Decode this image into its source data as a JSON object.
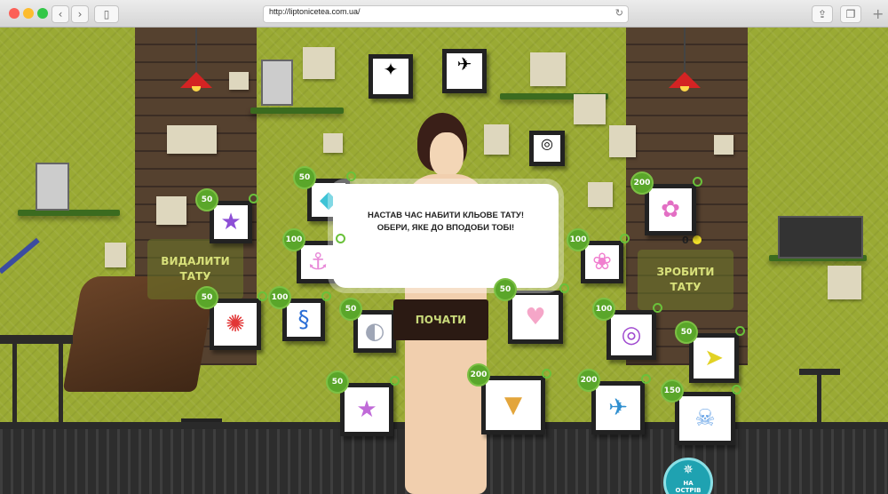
{
  "browser": {
    "url": "http://liptonicetea.com.ua/",
    "traffic_colors": [
      "#fc5f57",
      "#fdbc2e",
      "#33c748"
    ]
  },
  "game": {
    "remove_label_line1": "ВИДАЛИТИ",
    "remove_label_line2": "ТАТУ",
    "make_label_line1": "ЗРОБИТИ",
    "make_label_line2": "ТАТУ",
    "coin_count": "0",
    "modal_line1": "НАСТАВ ЧАС НАБИТИ КЛЬОВЕ ТАТУ!",
    "modal_line2": "ОБЕРИ, ЯКЕ ДО ВПОДОБИ ТОБІ!",
    "start_label": "ПОЧАТИ",
    "island_line1": "НА",
    "island_line2": "ОСТРІВ"
  },
  "tattoos": [
    {
      "name": "star-blue",
      "price": "50",
      "glyph": "★",
      "color": "#8d4fd6"
    },
    {
      "name": "diamond",
      "price": "50",
      "glyph": "◆",
      "color": "#3ec3d6"
    },
    {
      "name": "anchor",
      "price": "100",
      "glyph": "⚓",
      "color": "#e88ad8"
    },
    {
      "name": "crab",
      "price": "50",
      "glyph": "✺",
      "color": "#e23535"
    },
    {
      "name": "seahorse",
      "price": "100",
      "glyph": "§",
      "color": "#2c6fd6"
    },
    {
      "name": "shell",
      "price": "50",
      "glyph": "◐",
      "color": "#9fa6b6"
    },
    {
      "name": "starfish",
      "price": "50",
      "glyph": "★",
      "color": "#c06ad8"
    },
    {
      "name": "ice-cream",
      "price": "200",
      "glyph": "▼",
      "color": "#e3a53b"
    },
    {
      "name": "rose",
      "price": "200",
      "glyph": "✿",
      "color": "#e36fc4"
    },
    {
      "name": "flowers",
      "price": "100",
      "glyph": "❀",
      "color": "#f07fcf"
    },
    {
      "name": "lollipop",
      "price": "100",
      "glyph": "◎",
      "color": "#a04ad0"
    },
    {
      "name": "heart-banner",
      "price": "50",
      "glyph": "♥",
      "color": "#f5a6c8"
    },
    {
      "name": "fish",
      "price": "50",
      "glyph": "➤",
      "color": "#e2d224"
    },
    {
      "name": "swallow",
      "price": "200",
      "glyph": "✈",
      "color": "#2f8fd0"
    },
    {
      "name": "skull",
      "price": "150",
      "glyph": "☠",
      "color": "#6fa8e8"
    }
  ]
}
